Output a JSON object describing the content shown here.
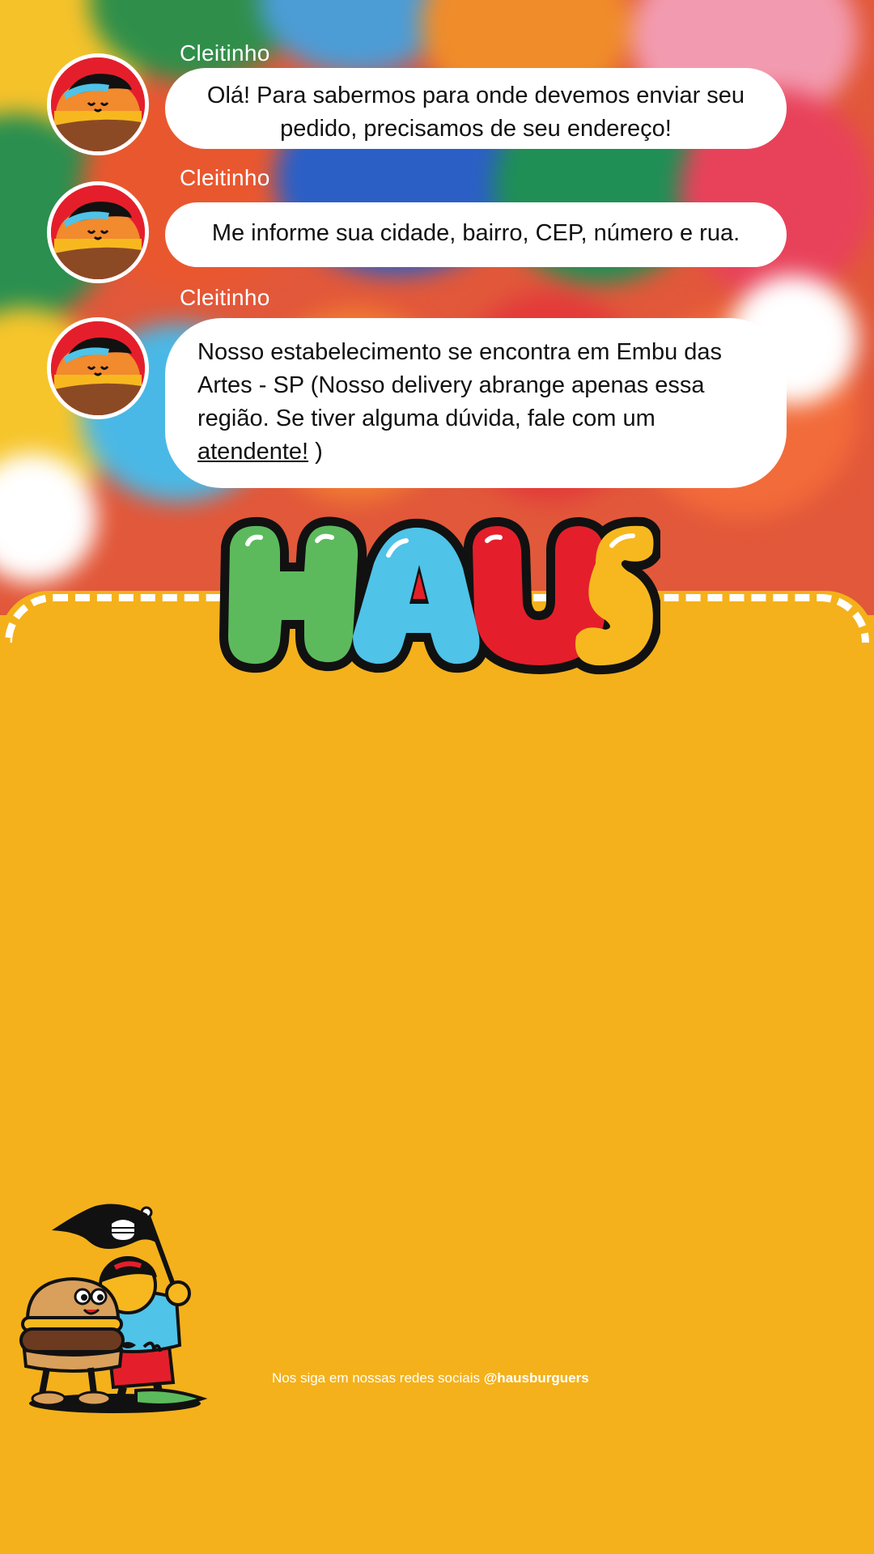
{
  "colors": {
    "panel_yellow": "#f4b11b",
    "bubble_white": "#ffffff",
    "logo_green": "#5cba5d",
    "logo_blue": "#4fc3e8",
    "logo_red": "#e41f2b",
    "logo_yellow": "#f7b81f"
  },
  "chat": {
    "messages": [
      {
        "sender": "Cleitinho",
        "text": "Olá! Para sabermos para onde devemos enviar seu pedido, precisamos de seu endereço!"
      },
      {
        "sender": "Cleitinho",
        "text": "Me informe sua cidade, bairro, CEP, número e rua."
      },
      {
        "sender": "Cleitinho",
        "text_before": "Nosso estabelecimento se encontra em Embu das Artes - SP  (Nosso delivery abrange apenas essa região. Se tiver alguma dúvida, fale com um ",
        "link_text": "atendente!",
        "text_after": " )"
      }
    ]
  },
  "logo": {
    "text": "HAUS"
  },
  "icons": {
    "avatar": "burger-mascot-avatar-icon",
    "flag": "burger-flag-icon",
    "mascot": "burger-mascots-illustration"
  },
  "footer": {
    "text": "Nos siga em nossas redes sociais ",
    "handle": "@hausburguers"
  }
}
